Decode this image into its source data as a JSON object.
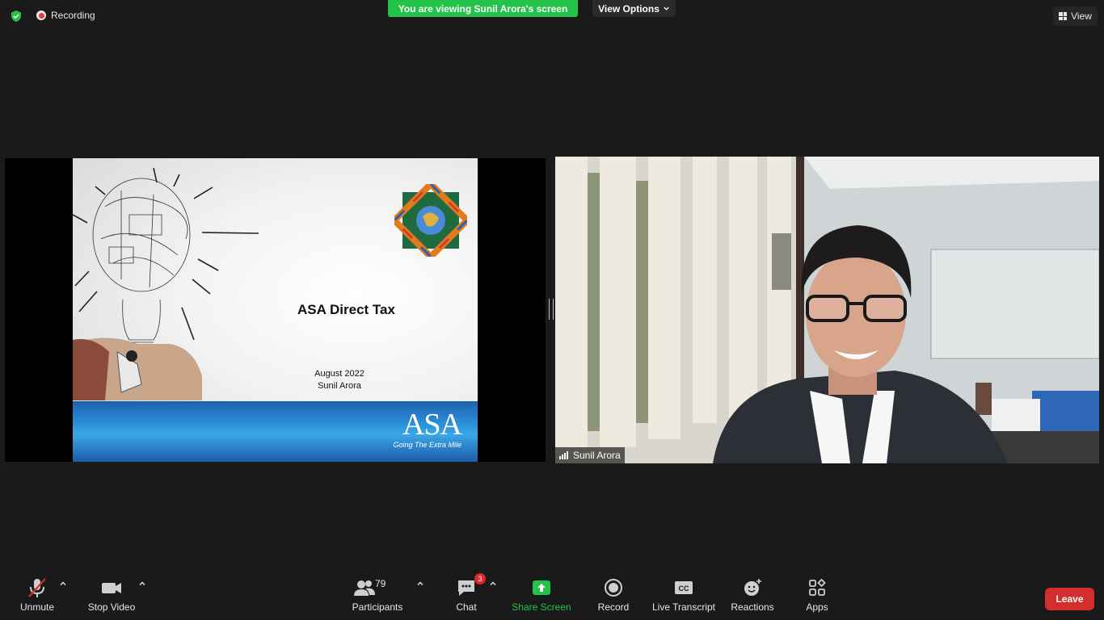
{
  "top_bar": {
    "recording_label": "Recording",
    "viewing_banner": "You are viewing Sunil Arora's screen",
    "view_options_label": "View Options",
    "view_label": "View",
    "banner_color": "#23c249"
  },
  "shared_screen": {
    "slide_title": "ASA Direct Tax",
    "slide_date": "August 2022",
    "slide_presenter": "Sunil Arora",
    "logo_text": "ASA",
    "logo_tagline": "Going The Extra Mile"
  },
  "video_tile": {
    "participant_name": "Sunil Arora"
  },
  "toolbar": {
    "unmute_label": "Unmute",
    "stop_video_label": "Stop Video",
    "participants_label": "Participants",
    "participants_count": "79",
    "chat_label": "Chat",
    "chat_badge": "3",
    "share_screen_label": "Share Screen",
    "record_label": "Record",
    "live_transcript_label": "Live Transcript",
    "reactions_label": "Reactions",
    "apps_label": "Apps",
    "leave_label": "Leave",
    "leave_color": "#d42d2d"
  }
}
